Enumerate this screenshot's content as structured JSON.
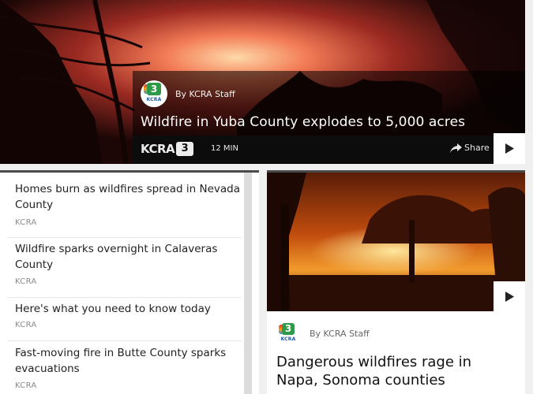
{
  "hero": {
    "byline": "By KCRA Staff",
    "title": "Wildfire in Yuba County explodes to 5,000 acres",
    "logo_text": "KCRA",
    "logo_number": "3",
    "time_ago": "12 MIN",
    "share_label": "Share",
    "play_icon": "play-icon"
  },
  "station_badge": {
    "number": "3",
    "text": "KCRA"
  },
  "list": {
    "items": [
      {
        "title": "Homes burn as wildfires spread in Nevada County",
        "source": "KCRA"
      },
      {
        "title": "Wildfire sparks overnight in Calaveras County",
        "source": "KCRA"
      },
      {
        "title": "Here's what you need to know today",
        "source": "KCRA"
      },
      {
        "title": "Fast-moving fire in Butte County sparks evacuations",
        "source": "KCRA"
      }
    ]
  },
  "card": {
    "byline": "By KCRA Staff",
    "title": "Dangerous wildfires rage in Napa, Sonoma counties",
    "play_icon": "play-icon"
  },
  "colors": {
    "badge_green": "#2e9a48",
    "divider": "#4a4a4a",
    "list_source": "#8b8b8b"
  }
}
